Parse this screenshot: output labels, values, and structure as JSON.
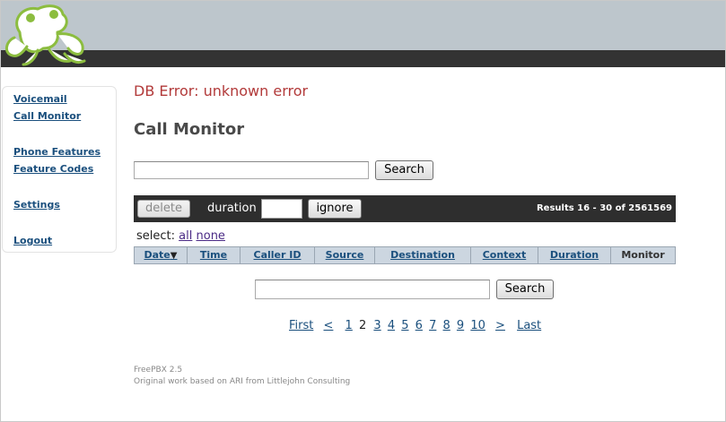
{
  "error": {
    "message": "DB Error: unknown error"
  },
  "page": {
    "title": "Call Monitor"
  },
  "sidebar": {
    "items": [
      {
        "label": "Voicemail"
      },
      {
        "label": "Call Monitor"
      },
      {
        "label": "Phone Features"
      },
      {
        "label": "Feature Codes"
      },
      {
        "label": "Settings"
      },
      {
        "label": "Logout"
      }
    ]
  },
  "search": {
    "top_value": "",
    "button_label": "Search",
    "bottom_value": ""
  },
  "toolbar": {
    "delete_label": "delete",
    "duration_label": "duration",
    "duration_value": "",
    "ignore_label": "ignore",
    "results_text": "Results 16 - 30 of 2561569"
  },
  "select": {
    "prefix": "select:",
    "all": "all",
    "none": "none"
  },
  "table": {
    "columns": [
      "Date",
      "Time",
      "Caller ID",
      "Source",
      "Destination",
      "Context",
      "Duration",
      "Monitor"
    ],
    "sort_indicator": "▼"
  },
  "pager": {
    "first": "First",
    "prev": "<",
    "pages": [
      "1",
      "2",
      "3",
      "4",
      "5",
      "6",
      "7",
      "8",
      "9",
      "10"
    ],
    "current": "2",
    "next": ">",
    "last": "Last"
  },
  "footer": {
    "version": "FreePBX 2.5",
    "credit": "Original work based on ARI from Littlejohn Consulting"
  },
  "colors": {
    "header_top": "#bdc6cc",
    "header_bar": "#333333",
    "link": "#1a4f7d",
    "error": "#b23a3a",
    "logo_green": "#8cbd3f"
  }
}
